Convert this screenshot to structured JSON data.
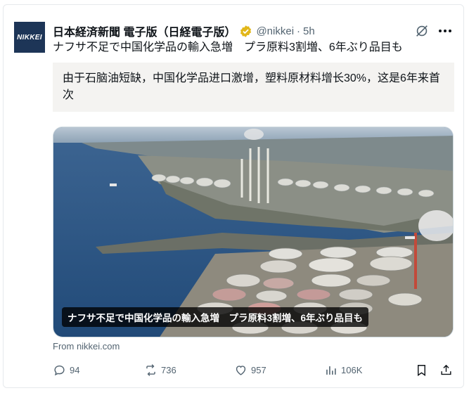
{
  "post": {
    "author_name": "日本経済新聞 電子版（日経電子版）",
    "handle": "@nikkei",
    "separator": "·",
    "time": "5h",
    "avatar_text": "NIKKEI",
    "text": "ナフサ不足で中国化学品の輸入急増　プラ原料3割増、6年ぶり品目も",
    "translation": "由于石脑油短缺，中国化学品进口激增，塑料原材料增长30%，这是6年来首次",
    "media_caption": "ナフサ不足で中国化学品の輸入急増　プラ原料3割増、6年ぶり品目も",
    "source": "From nikkei.com"
  },
  "actions": {
    "replies": "94",
    "reposts": "736",
    "likes": "957",
    "views": "106K"
  },
  "colors": {
    "verified_gold": "#e2b719",
    "text_secondary": "#536471",
    "translation_bg": "#f4f3f1"
  }
}
